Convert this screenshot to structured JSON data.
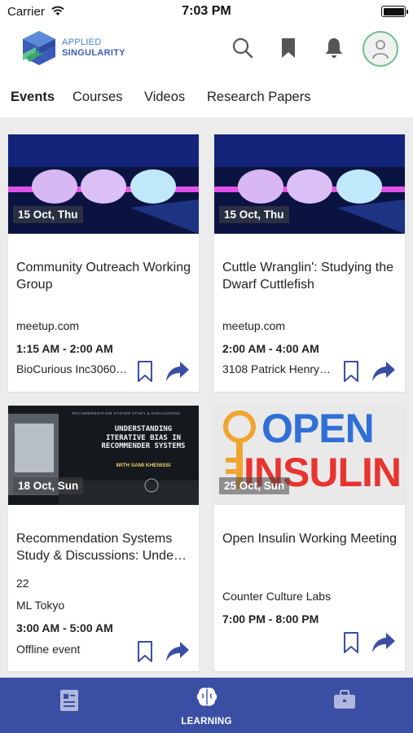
{
  "status_bar": {
    "carrier": "Carrier",
    "time": "7:03 PM"
  },
  "header": {
    "logo_line1": "APPLIED",
    "logo_line2": "SINGULARITY",
    "icons": [
      "search-icon",
      "bookmark-icon",
      "bell-icon",
      "avatar"
    ]
  },
  "tabs": [
    {
      "label": "Events",
      "active": true
    },
    {
      "label": "Courses",
      "active": false
    },
    {
      "label": "Videos",
      "active": false
    },
    {
      "label": "Research Papers",
      "active": false
    }
  ],
  "events": [
    {
      "date": "15 Oct, Thu",
      "title": "Community Outreach Working Group",
      "site": "meetup.com",
      "time": "1:15 AM - 2:00 AM",
      "location": "BioCurious Inc3060…"
    },
    {
      "date": "15 Oct, Thu",
      "title": "Cuttle Wranglin': Studying the Dwarf Cuttlefish",
      "site": "meetup.com",
      "time": "2:00 AM - 4:00 AM",
      "location": "3108 Patrick Henry…"
    },
    {
      "date": "18 Oct, Sun",
      "title": "Recommendation Systems Study & Discussions: Unde…",
      "image_caption_small": "RECOMMENDATION SYSTEM STUDY & DISCUSSIONS",
      "image_caption": "UNDERSTANDING ITERATIVE BIAS IN RECOMMENDER SYSTEMS",
      "image_subcaption": "WITH SAMI KHENISSI",
      "count": "22",
      "group": "ML Tokyo",
      "time": "3:00 AM - 5:00 AM",
      "location": "Offline event"
    },
    {
      "date": "25 Oct, Sun",
      "title": "Open Insulin Working Meeting",
      "image_word1": "OPEN",
      "image_word2": "INSULIN",
      "location": "Counter Culture Labs",
      "time": "7:00 PM - 8:00 PM"
    }
  ],
  "bottom_nav": [
    {
      "label": "",
      "icon": "news-icon"
    },
    {
      "label": "LEARNING",
      "icon": "brain-icon",
      "active": true
    },
    {
      "label": "",
      "icon": "briefcase-icon"
    }
  ],
  "colors": {
    "brand": "#3a4fa3",
    "accent_green": "#6dbf8e"
  }
}
